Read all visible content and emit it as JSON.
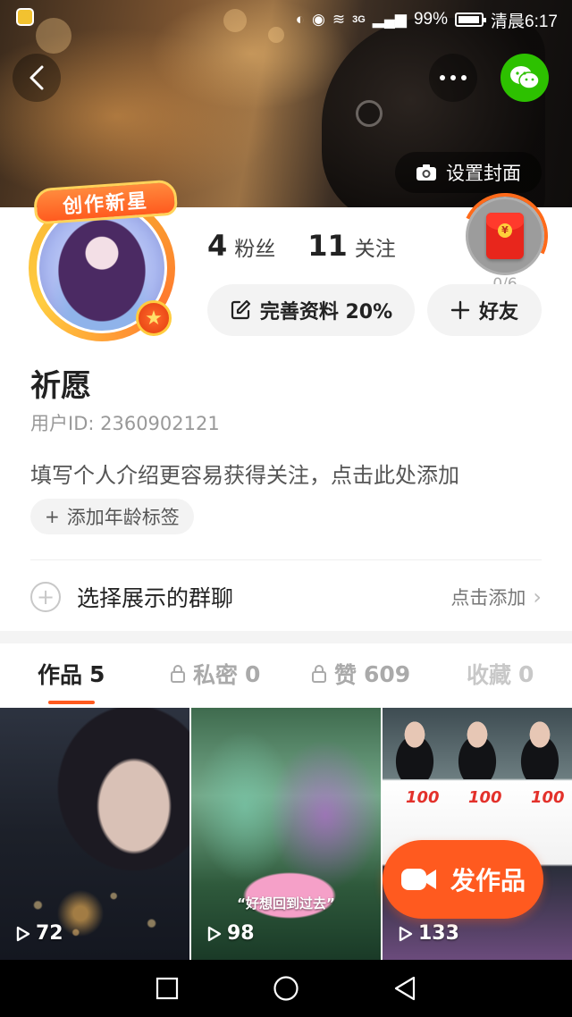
{
  "status_bar": {
    "network": "3G",
    "battery": "99%",
    "time": "清晨6:17"
  },
  "header": {
    "set_cover_label": "设置封面"
  },
  "profile": {
    "badge_text": "创作新星",
    "followers_count": "4",
    "followers_label": "粉丝",
    "following_count": "11",
    "following_label": "关注",
    "red_packet_count": "0/6",
    "complete_profile_label": "完善资料 20%",
    "add_friend_label": "好友",
    "name": "祈愿",
    "user_id": "用户ID: 2360902121",
    "bio_placeholder": "填写个人介绍更容易获得关注，点击此处添加",
    "age_tag_label": "添加年龄标签"
  },
  "group_chat": {
    "label": "选择展示的群聊",
    "action": "点击添加"
  },
  "tabs": [
    {
      "label": "作品",
      "count": "5"
    },
    {
      "label": "私密",
      "count": "0"
    },
    {
      "label": "赞",
      "count": "609"
    },
    {
      "label": "收藏",
      "count": "0"
    }
  ],
  "videos": [
    {
      "plays": "72"
    },
    {
      "plays": "98",
      "caption": "“好想回到过去”"
    },
    {
      "plays": "133",
      "overlay": "100"
    }
  ],
  "publish_button": {
    "label": "发作品"
  },
  "colors": {
    "accent": "#ff5a1f",
    "wechat": "#2dc100",
    "red_packet": "#e8261c"
  }
}
